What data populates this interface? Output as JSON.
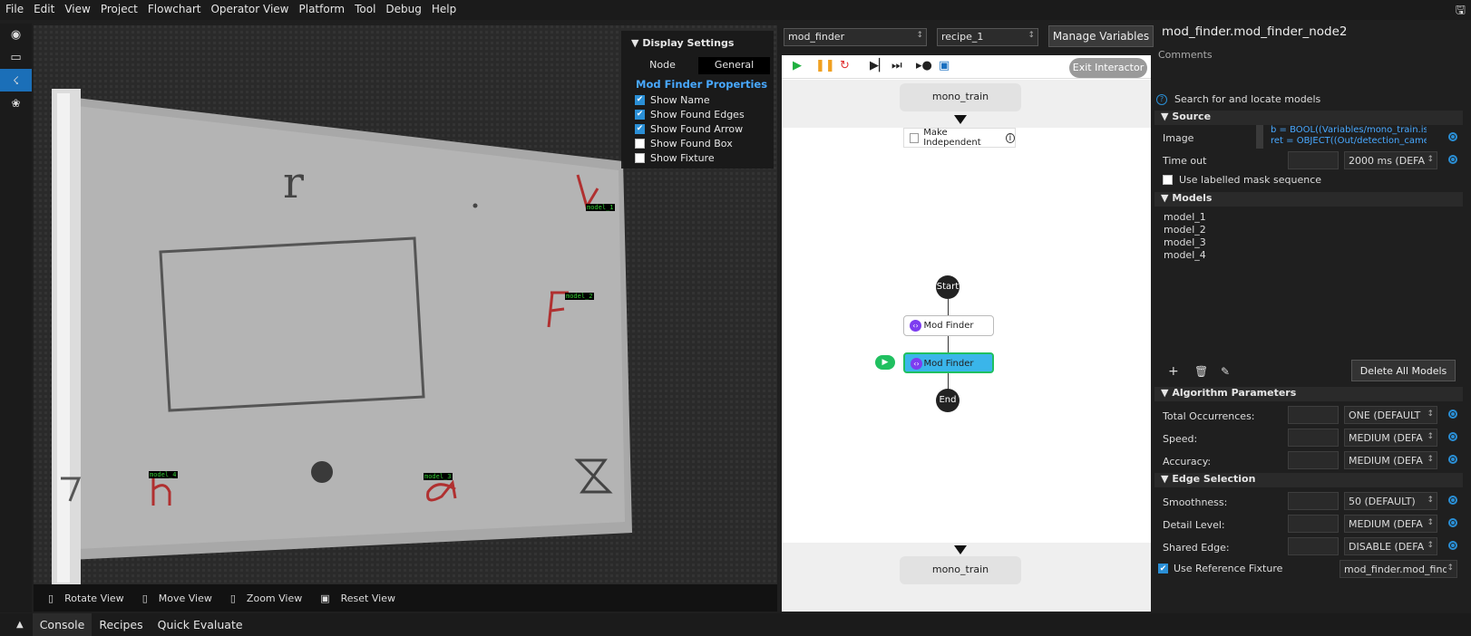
{
  "menu": [
    "File",
    "Edit",
    "View",
    "Project",
    "Flowchart",
    "Operator View",
    "Platform",
    "Tool",
    "Debug",
    "Help"
  ],
  "viewer": {
    "toolbar": {
      "rotate": "Rotate View",
      "move": "Move View",
      "zoom": "Zoom View",
      "reset": "Reset View"
    },
    "display_settings": {
      "title": "Display Settings",
      "tab_node": "Node",
      "tab_general": "General",
      "section": "Mod Finder Properties",
      "options": [
        {
          "label": "Show Name",
          "checked": true
        },
        {
          "label": "Show Found Edges",
          "checked": true
        },
        {
          "label": "Show Found Arrow",
          "checked": true
        },
        {
          "label": "Show Found Box",
          "checked": false
        },
        {
          "label": "Show Fixture",
          "checked": false
        }
      ]
    },
    "labels": [
      "model_1",
      "model_2",
      "model_4",
      "model_3"
    ]
  },
  "flowchart": {
    "module_select": "mod_finder",
    "recipe_select": "recipe_1",
    "manage_variables": "Manage Variables",
    "exit_interactor": "Exit Interactor",
    "top_node": "mono_train",
    "make_independent": "Make Independent",
    "start": "Start",
    "node1": "Mod Finder",
    "node2": "Mod Finder",
    "end": "End",
    "bottom_node": "mono_train"
  },
  "properties": {
    "title": "mod_finder.mod_finder_node2",
    "comments": "Comments",
    "description": "Search for and locate models",
    "source": {
      "header": "Source",
      "image_label": "Image",
      "image_lines": [
        "b = BOOL((Variables/mono_train.is_tra",
        "ret = OBJECT((Out/detection_camera_r"
      ],
      "timeout_label": "Time out",
      "timeout_value": "2000 ms (DEFA",
      "use_mask": "Use labelled mask sequence"
    },
    "models": {
      "header": "Models",
      "items": [
        "model_1",
        "model_2",
        "model_3",
        "model_4"
      ],
      "delete_all": "Delete All Models"
    },
    "algorithm": {
      "header": "Algorithm Parameters",
      "rows": [
        {
          "label": "Total Occurrences:",
          "value": "ONE (DEFAULT"
        },
        {
          "label": "Speed:",
          "value": "MEDIUM (DEFA"
        },
        {
          "label": "Accuracy:",
          "value": "MEDIUM (DEFA"
        }
      ]
    },
    "edge": {
      "header": "Edge Selection",
      "rows": [
        {
          "label": "Smoothness:",
          "value": "50 (DEFAULT)"
        },
        {
          "label": "Detail Level:",
          "value": "MEDIUM (DEFA"
        },
        {
          "label": "Shared Edge:",
          "value": "DISABLE (DEFA"
        }
      ],
      "fixture_label": "Use Reference Fixture",
      "fixture_value": "mod_finder.mod_find"
    }
  },
  "bottom_tabs": [
    "Console",
    "Recipes",
    "Quick Evaluate"
  ]
}
